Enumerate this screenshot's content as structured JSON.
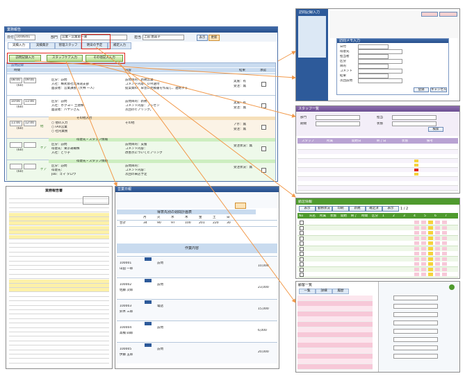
{
  "main": {
    "window_title": "業務報告",
    "date_label": "日付",
    "date_value": "14/06/01",
    "dept_label": "部門",
    "dept_value": "営業・営業第一課",
    "emp_label": "担当",
    "emp_value": "上田 由美子",
    "show_button": "表示",
    "update_button": "更新",
    "tabs": [
      "実績入力",
      "実績集計",
      "管理スタッフ",
      "明日の予定",
      "補足入力"
    ],
    "action_buttons": [
      "訪問記録入力",
      "スタッフケア入力",
      "その他記入入力"
    ],
    "col_headers": {
      "time": "時間",
      "contents": "内容",
      "result": "結果",
      "confirm": "承認"
    },
    "section_label": "訪問記録",
    "rows": [
      {
        "start": "08:00",
        "end": "09:00",
        "dur": "(60)",
        "kind": "",
        "l1": "区分：訪問",
        "l2": "入社：株式会社北海道支部",
        "l3": "面談者：営業課長（大林 一人）",
        "m1": "訪問目的：新規営業",
        "m2": "コメント内容：ＤＭ送付",
        "m3": "提案資料：早急に見積書を作成し、連絡する",
        "r1": "実施：有",
        "r2": "受注：無"
      },
      {
        "start": "10:00",
        "end": "11:00",
        "dur": "(60)",
        "kind": "",
        "l1": "区分：訪問",
        "l2": "入社：ホクヨー 土建株",
        "l3": "面談者：ハヤシさん",
        "m1": "訪問目的：新規",
        "m2": "コメント内容：プレゼン",
        "m3": "次回のヒアリング。",
        "r1": "実施：有",
        "r2": "受注：無"
      },
      {
        "start": "11:00",
        "end": "12:00",
        "dur": "(60)",
        "kind": "他",
        "l1": "○ 他の入力",
        "l2": "○ FAX営業",
        "l3": "○ 社内業務",
        "m1": "その他",
        "m2": "",
        "m3": "",
        "r1": "アポ：無",
        "r2": "受注：無"
      },
      {
        "start": "",
        "end": "",
        "dur": "(60)",
        "kind": "ケア",
        "l1": "区分：訪問",
        "l2": "得意先：東京運輸株",
        "l3": "入社：どり子",
        "m1": "訪問目的：支援",
        "m2": "コメント内容：",
        "m3": "改善点についてヒアリング",
        "r1": "受注状況：無",
        "r2": ""
      },
      {
        "start": "",
        "end": "",
        "dur": "(60)",
        "kind": "ケア",
        "l1": "区分：訪問",
        "l2": "得意先：",
        "l3": "Job：ゴマ タロウ",
        "m1": "訪問目的：",
        "m2": "コメント内容：",
        "m3": "次回の来店予定",
        "r1": "受注状況：無",
        "r2": ""
      }
    ],
    "staff_header": "得意先・スタッフ情報",
    "other_header": "その他入力"
  },
  "top_right": {
    "title": "訪問記録入力",
    "panel_title": "訪問メモ入力",
    "fields": [
      "日付",
      "得意先",
      "担当者",
      "区分",
      "目的",
      "コメント",
      "結果",
      "次回訪問"
    ],
    "buttons": [
      "登録",
      "キャンセル"
    ]
  },
  "mid_right": {
    "title": "スタッフ一覧",
    "filters": [
      "部門",
      "担当",
      "期間",
      "状態"
    ],
    "button": "検索",
    "cols": [
      "スタッフ",
      "所属",
      "開始日",
      "終了日",
      "状態",
      "備考"
    ]
  },
  "low_right": {
    "title": "勤怠情報",
    "toolbar": [
      "表示",
      "勤務状況",
      "印刷",
      "新規",
      "確定済",
      "表示"
    ],
    "cols": [
      "No",
      "氏名",
      "所属",
      "状態",
      "開始",
      "終了",
      "時間",
      "区分",
      "1",
      "2",
      "3",
      "4",
      "5",
      "6",
      "7"
    ],
    "page": "1 / 2"
  },
  "bottom_right": {
    "title": "顧客一覧",
    "tabs": [
      "一覧",
      "詳細",
      "履歴"
    ]
  },
  "report_panel": {
    "title": "営業日報",
    "header": "得意先別の週間計画表",
    "sub_header": "作業内容",
    "stats": [
      34,
      90,
      97,
      100,
      201,
      220,
      30,
      1,
      2,
      3,
      4,
      5,
      6
    ],
    "total_label": "合計",
    "cols": [
      "月",
      "火",
      "水",
      "木",
      "金",
      "土",
      "日"
    ],
    "entries": [
      {
        "code": "100001",
        "name": "山田 一郎",
        "type": "訪問",
        "amount": "10,000"
      },
      {
        "code": "100002",
        "name": "佐藤 次郎",
        "type": "訪問",
        "amount": "23,000"
      },
      {
        "code": "100003",
        "name": "鈴木 三郎",
        "type": "電話",
        "amount": "15,000"
      },
      {
        "code": "100004",
        "name": "高橋 四郎",
        "type": "訪問",
        "amount": "6,000"
      },
      {
        "code": "100005",
        "name": "伊藤 五郎",
        "type": "訪問",
        "amount": "20,000"
      }
    ]
  },
  "doc_panel": {
    "title": "業務報告書"
  },
  "colors": {
    "accent": "#e0261b",
    "arrow": "#f2994a",
    "titlebar": "#2d5a9a",
    "green": "#4f9a2e",
    "pink": "#f7c8d8"
  }
}
